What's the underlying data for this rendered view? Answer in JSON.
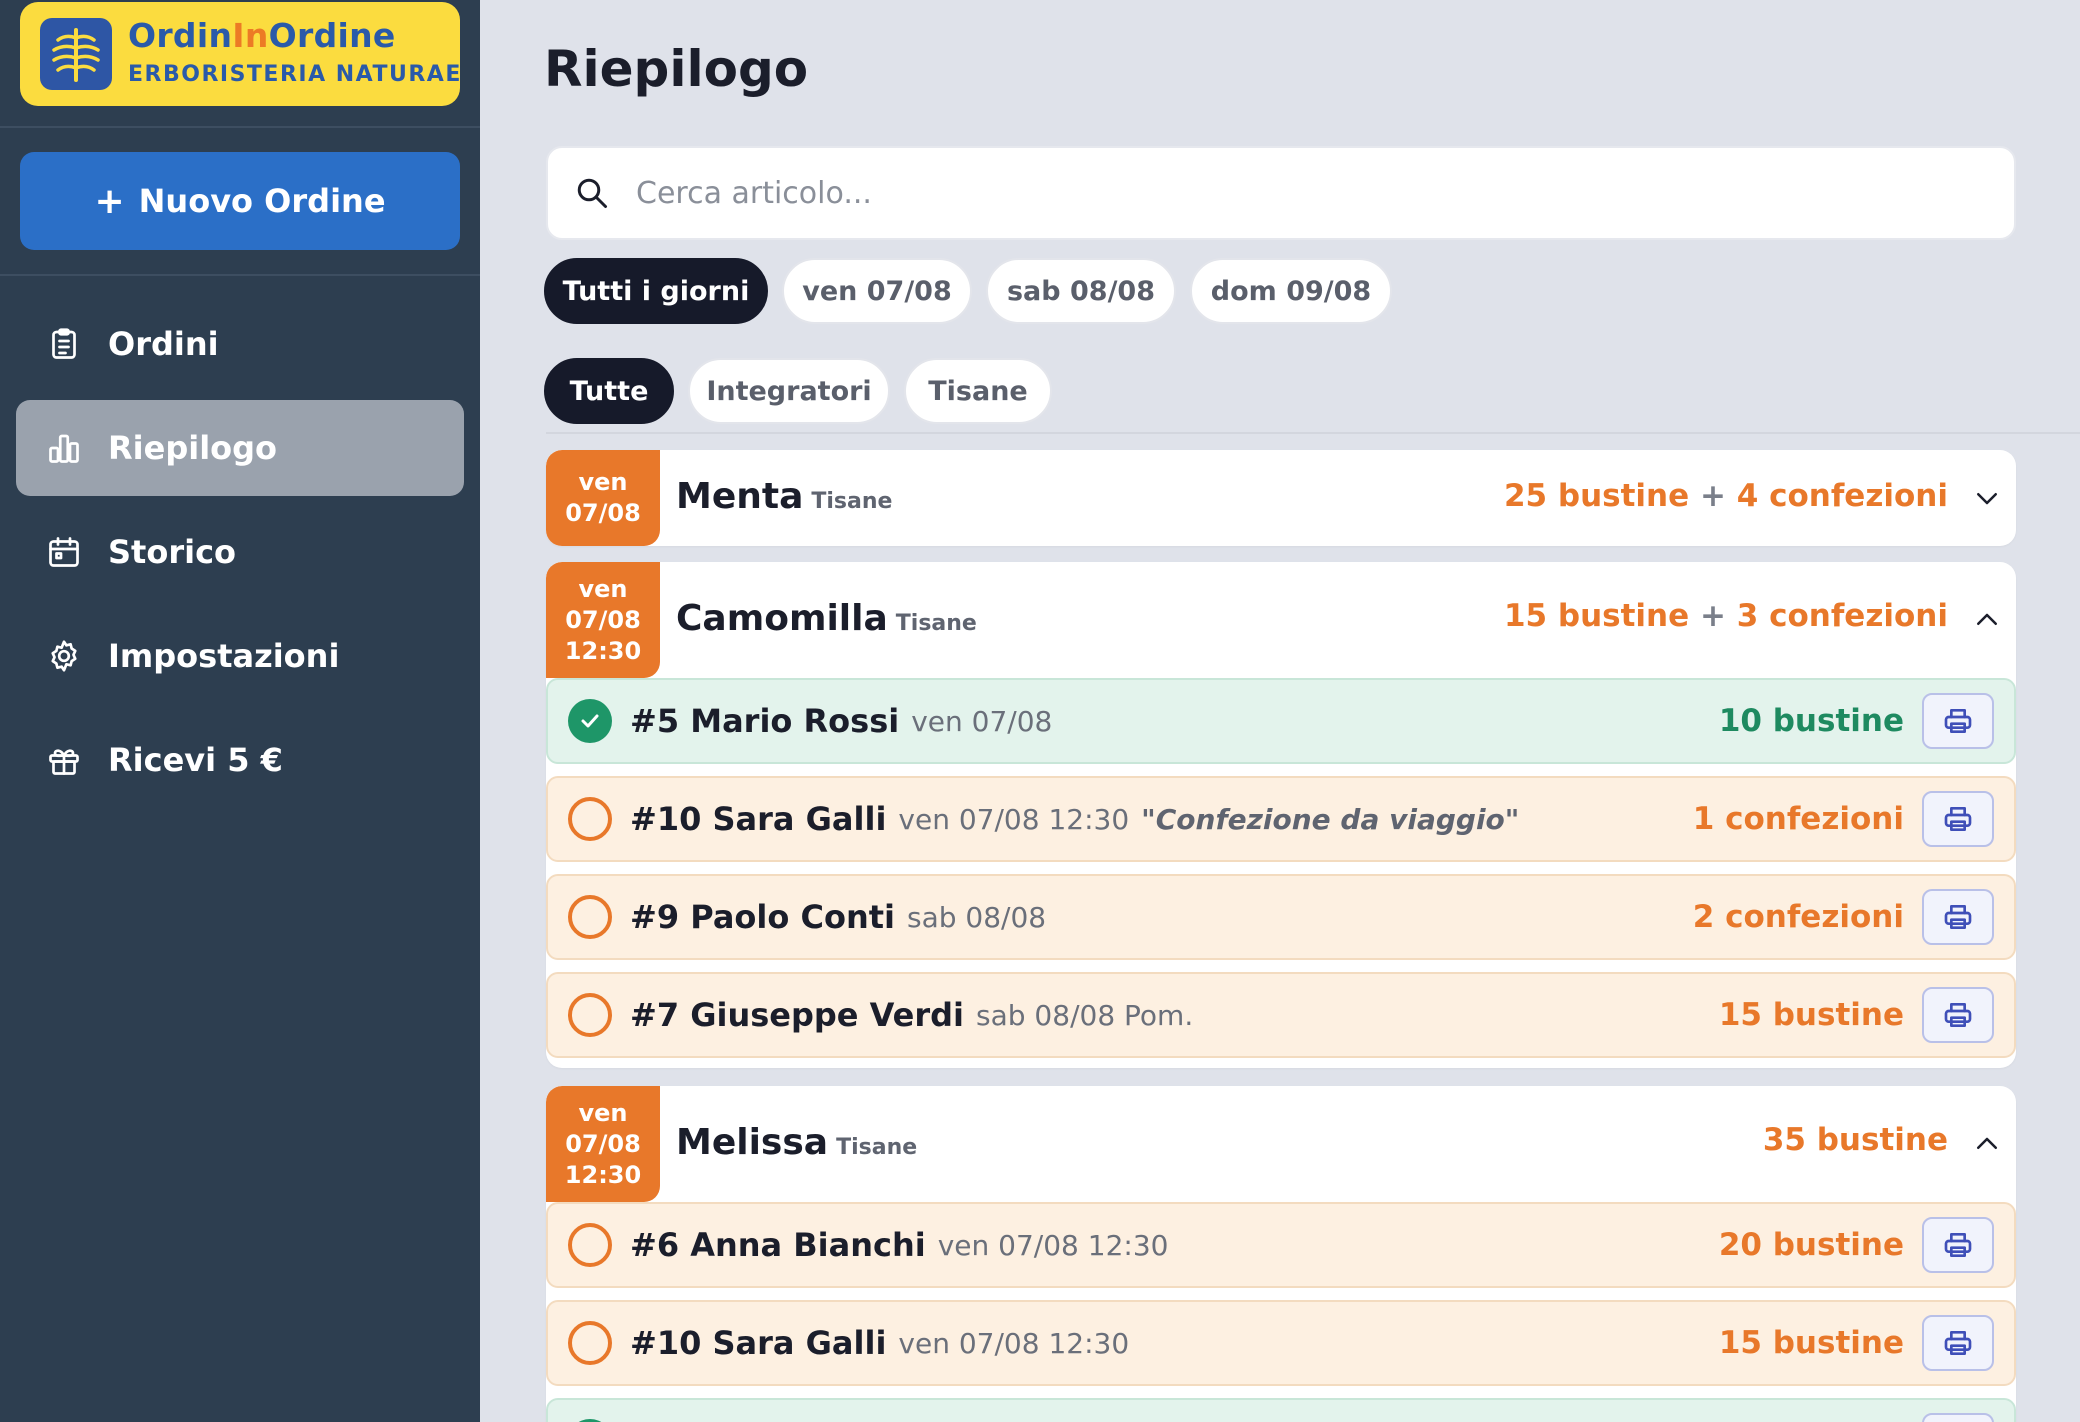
{
  "app": {
    "brand_part1": "Ordin",
    "brand_part2": "In",
    "brand_part3": "Ordine",
    "brand_subtitle": "ERBORISTERIA NATURAE",
    "logo_icon": "leaf-logo-icon"
  },
  "colors": {
    "sidebar": "#2d3e50",
    "brand_yellow": "#fbdc3f",
    "primary_blue": "#2b6fc7",
    "accent_orange": "#e8782a",
    "done_green": "#1e9668",
    "page_bg": "#dfe2ea"
  },
  "sidebar": {
    "new_order_label": "Nuovo Ordine",
    "items": [
      {
        "label": "Ordini",
        "icon": "clipboard-icon",
        "active": false
      },
      {
        "label": "Riepilogo",
        "icon": "bar-chart-icon",
        "active": true
      },
      {
        "label": "Storico",
        "icon": "calendar-icon",
        "active": false
      },
      {
        "label": "Impostazioni",
        "icon": "gear-icon",
        "active": false
      },
      {
        "label": "Ricevi 5 €",
        "icon": "gift-icon",
        "active": false
      }
    ]
  },
  "main": {
    "title": "Riepilogo",
    "search_placeholder": "Cerca articolo...",
    "day_filters": [
      "Tutti i giorni",
      "ven 07/08",
      "sab 08/08",
      "dom 09/08"
    ],
    "day_filter_selected": "Tutti i giorni",
    "category_filters": [
      "Tutte",
      "Integratori",
      "Tisane"
    ],
    "category_filter_selected": "Tutte"
  },
  "cards": [
    {
      "day_line1": "ven",
      "day_line2": "07/08",
      "name": "Menta",
      "category": "Tisane",
      "total_part1": "25 bustine",
      "total_plus": "+",
      "total_part2": "4 confezioni",
      "expanded": false
    },
    {
      "day_line1": "ven",
      "day_line2": "07/08",
      "day_line3": "12:30",
      "name": "Camomilla",
      "category": "Tisane",
      "total_part1": "15 bustine",
      "total_plus": "+",
      "total_part2": "3 confezioni",
      "expanded": true,
      "orders": [
        {
          "id": "#5 Mario Rossi",
          "when": "ven 07/08",
          "note": "",
          "qty": "10 bustine",
          "done": true
        },
        {
          "id": "#10 Sara Galli",
          "when": "ven 07/08 12:30",
          "note": "\"Confezione da viaggio\"",
          "qty": "1 confezioni",
          "done": false
        },
        {
          "id": "#9 Paolo Conti",
          "when": "sab 08/08",
          "note": "",
          "qty": "2 confezioni",
          "done": false
        },
        {
          "id": "#7 Giuseppe Verdi",
          "when": "sab 08/08 Pom.",
          "note": "",
          "qty": "15 bustine",
          "done": false
        }
      ]
    },
    {
      "day_line1": "ven",
      "day_line2": "07/08",
      "day_line3": "12:30",
      "name": "Melissa",
      "category": "Tisane",
      "total_part1": "35 bustine",
      "expanded": true,
      "orders": [
        {
          "id": "#6 Anna Bianchi",
          "when": "ven 07/08 12:30",
          "note": "",
          "qty": "20 bustine",
          "done": false
        },
        {
          "id": "#10 Sara Galli",
          "when": "ven 07/08 12:30",
          "note": "",
          "qty": "15 bustine",
          "done": false
        }
      ]
    }
  ]
}
